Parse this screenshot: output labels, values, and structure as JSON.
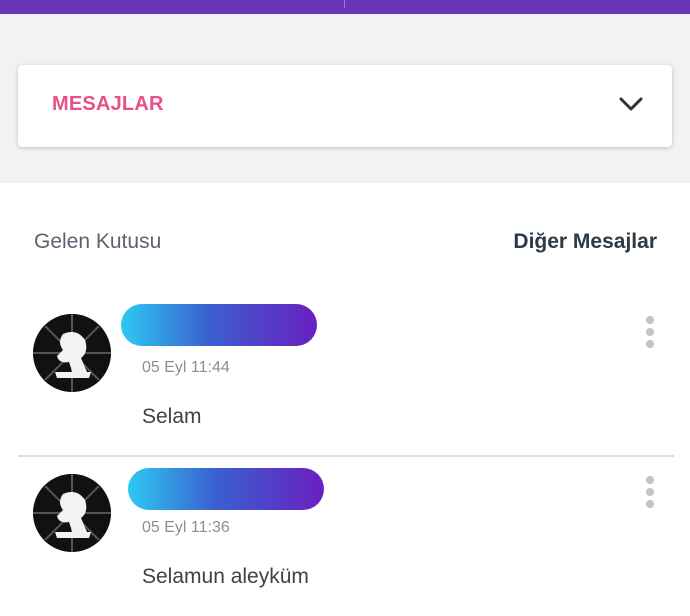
{
  "filter": {
    "selected_label": "MESAJLAR",
    "accent_color": "#e8508a"
  },
  "tabs": {
    "inbox_label": "Gelen Kutusu",
    "other_label": "Diğer Mesajlar"
  },
  "messages": [
    {
      "time": "05 Eyl 11:44",
      "text": "Selam"
    },
    {
      "time": "05 Eyl 11:36",
      "text": "Selamun aleyküm"
    }
  ],
  "colors": {
    "top_bar": "#6a35b8",
    "name_gradient_start": "#2ec9f2",
    "name_gradient_end": "#6a1fc0"
  },
  "icons": {
    "dropdown": "chevron-down-icon",
    "message_menu": "more-vertical-icon"
  }
}
